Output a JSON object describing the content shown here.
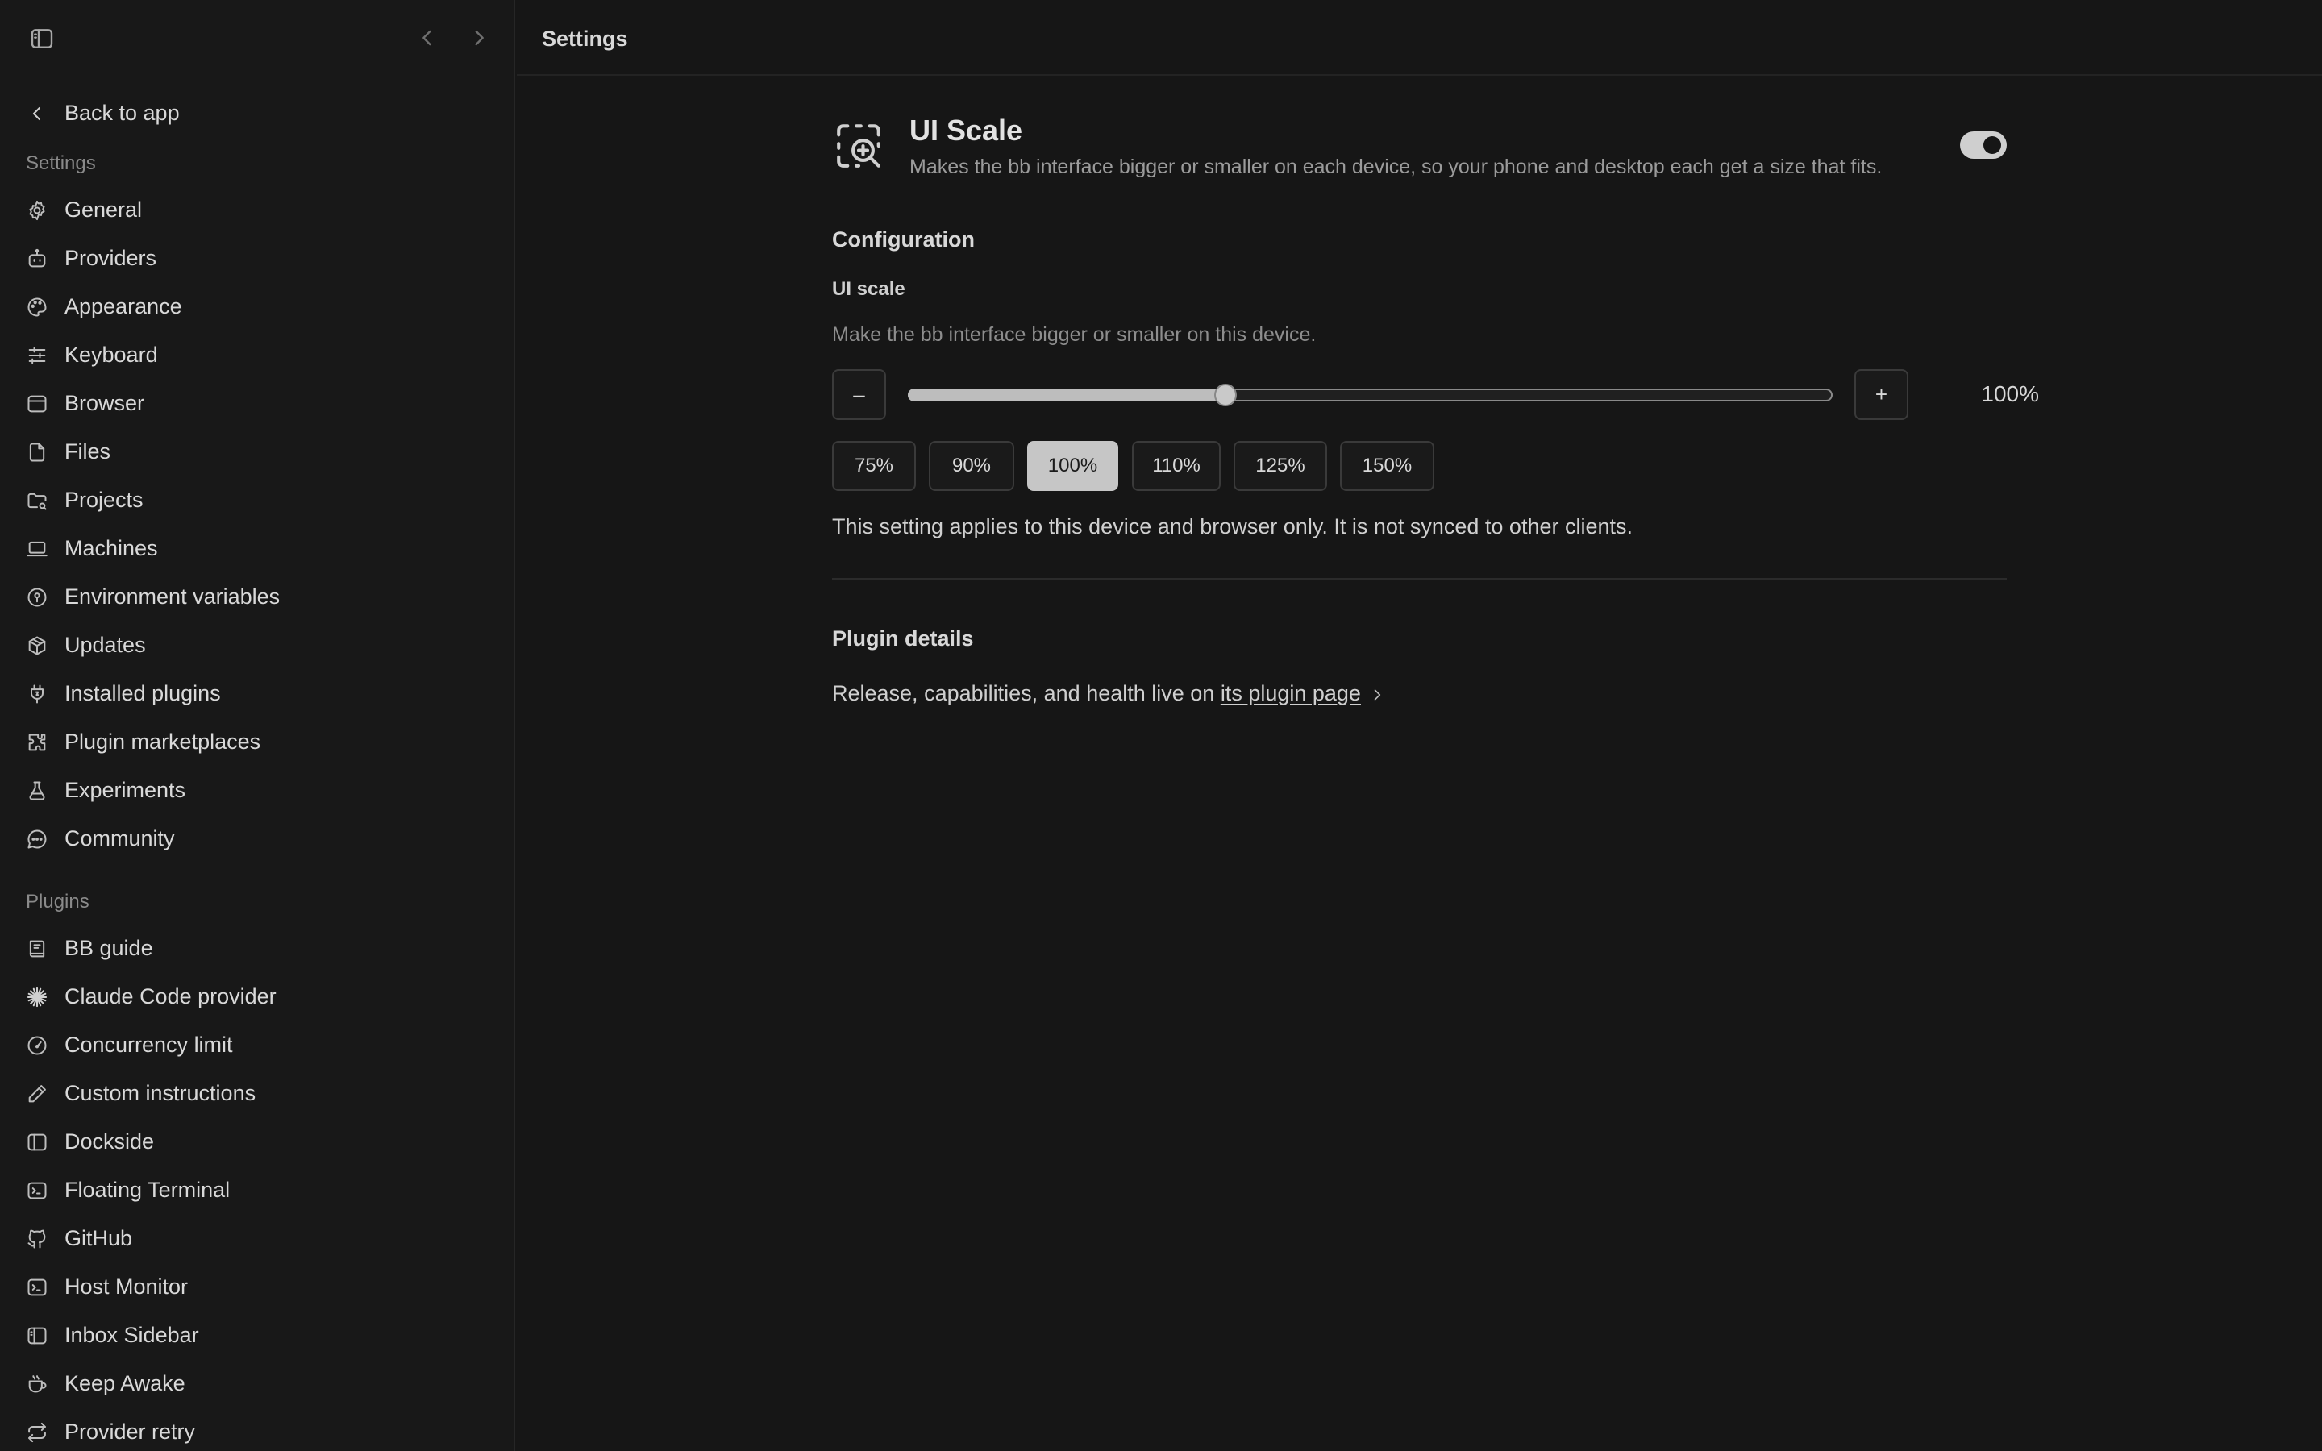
{
  "header": {
    "title": "Settings"
  },
  "sidebar": {
    "back_label": "Back to app",
    "settings_label": "Settings",
    "plugins_label": "Plugins",
    "settings_items": [
      {
        "label": "General",
        "icon": "gear-icon"
      },
      {
        "label": "Providers",
        "icon": "bot-icon"
      },
      {
        "label": "Appearance",
        "icon": "palette-icon"
      },
      {
        "label": "Keyboard",
        "icon": "sliders-icon"
      },
      {
        "label": "Browser",
        "icon": "browser-icon"
      },
      {
        "label": "Files",
        "icon": "file-icon"
      },
      {
        "label": "Projects",
        "icon": "folder-icon"
      },
      {
        "label": "Machines",
        "icon": "laptop-icon"
      },
      {
        "label": "Environment variables",
        "icon": "location-pin-icon"
      },
      {
        "label": "Updates",
        "icon": "package-icon"
      },
      {
        "label": "Installed plugins",
        "icon": "plug-icon"
      },
      {
        "label": "Plugin marketplaces",
        "icon": "puzzle-icon"
      },
      {
        "label": "Experiments",
        "icon": "flask-icon"
      },
      {
        "label": "Community",
        "icon": "chat-bubble-icon"
      }
    ],
    "plugin_items": [
      {
        "label": "BB guide",
        "icon": "book-icon"
      },
      {
        "label": "Claude Code provider",
        "icon": "asterisk-burst-icon"
      },
      {
        "label": "Concurrency limit",
        "icon": "gauge-icon"
      },
      {
        "label": "Custom instructions",
        "icon": "pencil-icon"
      },
      {
        "label": "Dockside",
        "icon": "panel-left-icon"
      },
      {
        "label": "Floating Terminal",
        "icon": "terminal-icon"
      },
      {
        "label": "GitHub",
        "icon": "github-icon"
      },
      {
        "label": "Host Monitor",
        "icon": "terminal-icon"
      },
      {
        "label": "Inbox Sidebar",
        "icon": "panel-left-icon"
      },
      {
        "label": "Keep Awake",
        "icon": "coffee-icon"
      },
      {
        "label": "Provider retry",
        "icon": "repeat-icon"
      }
    ]
  },
  "plugin": {
    "name": "UI Scale",
    "description": "Makes the bb interface bigger or smaller on each device, so your phone and desktop each get a size that fits.",
    "enabled": true,
    "icon": "zoom-in-dashed-icon"
  },
  "config": {
    "heading": "Configuration",
    "field_label": "UI scale",
    "hint": "Make the bb interface bigger or smaller on this device.",
    "minus_label": "–",
    "plus_label": "+",
    "value_text": "100%",
    "slider_fraction": 0.34,
    "presets": [
      "75%",
      "90%",
      "100%",
      "110%",
      "125%",
      "150%"
    ],
    "active_preset": "100%",
    "note": "This setting applies to this device and browser only. It is not synced to other clients."
  },
  "details": {
    "heading": "Plugin details",
    "text": "Release, capabilities, and health live on ",
    "link_label": "its plugin page"
  },
  "colors": {
    "background": "#161616",
    "sidebar": "#181818",
    "accent": "#c6c6c6"
  }
}
